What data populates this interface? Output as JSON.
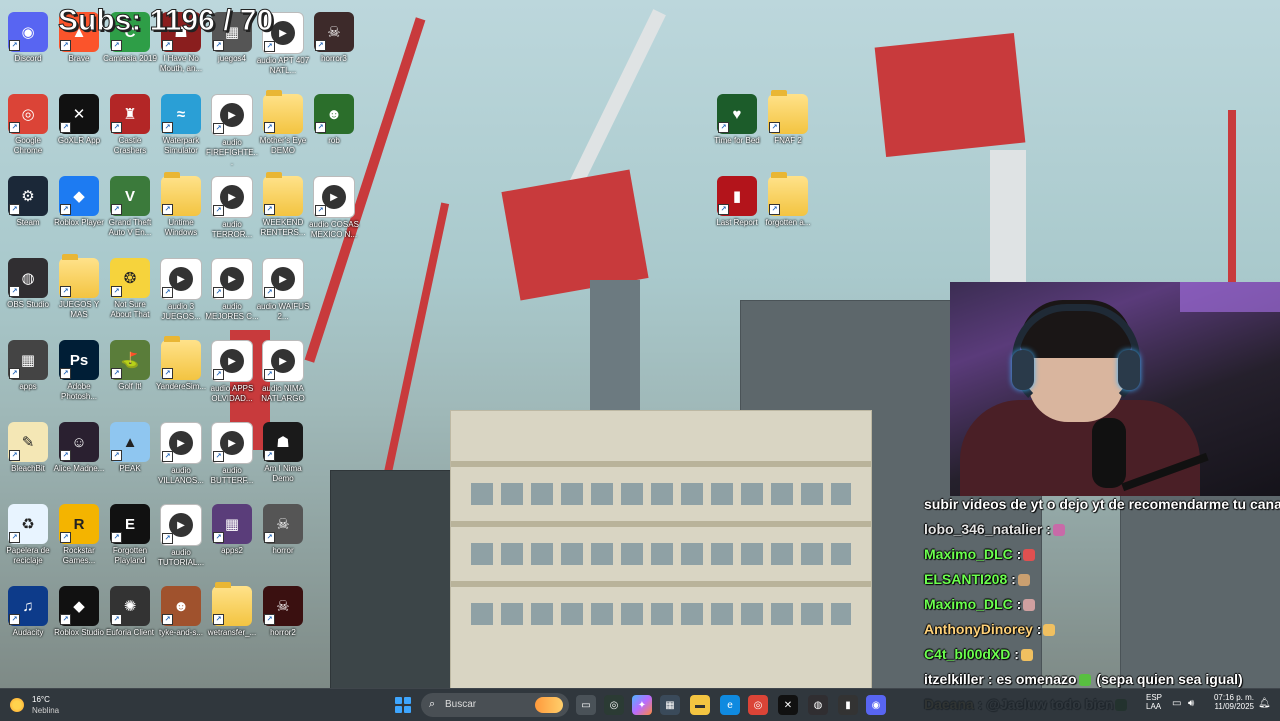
{
  "overlay": {
    "subs_text": "Subs: 1196 / 70"
  },
  "desktop": {
    "icons": [
      {
        "label": "Discord",
        "color": "#5865F2",
        "glyph": "◉"
      },
      {
        "label": "Brave",
        "color": "#fb542b",
        "glyph": "▲"
      },
      {
        "label": "Camtasia 2019",
        "color": "#2e9e47",
        "glyph": "C"
      },
      {
        "label": "I Have No Mouth, an...",
        "color": "#8a1e1e",
        "glyph": "☗"
      },
      {
        "label": "juegos4",
        "color": "#555",
        "glyph": "▦"
      },
      {
        "label": "audio APT 407 NATL...",
        "color": "#fff",
        "glyph": "▶"
      },
      {
        "label": "horror3",
        "color": "#3d2a2a",
        "glyph": "☠"
      },
      {
        "label": "Google Chrome",
        "color": "#db4437",
        "glyph": "◎"
      },
      {
        "label": "GoXLR App",
        "color": "#111",
        "glyph": "✕"
      },
      {
        "label": "Castle Crashers",
        "color": "#b32626",
        "glyph": "♜"
      },
      {
        "label": "Waterpark Simulator",
        "color": "#2a9fd6",
        "glyph": "≈"
      },
      {
        "label": "audio FIREFIGHTE...",
        "color": "#fff",
        "glyph": "▶"
      },
      {
        "label": "Mother's Eye DEMO",
        "color": "folder",
        "glyph": ""
      },
      {
        "label": "rob",
        "color": "#2b6e2b",
        "glyph": "☻"
      },
      {
        "label": "Steam",
        "color": "#1b2838",
        "glyph": "⚙"
      },
      {
        "label": "Roblox Player",
        "color": "#1d7bf2",
        "glyph": "◆"
      },
      {
        "label": "Grand Theft Auto V En...",
        "color": "#3b7a3b",
        "glyph": "V"
      },
      {
        "label": "Untime Windows",
        "color": "folder",
        "glyph": ""
      },
      {
        "label": "audio TERROR...",
        "color": "#fff",
        "glyph": "▶"
      },
      {
        "label": "WEEKEND RENTERS...",
        "color": "folder",
        "glyph": ""
      },
      {
        "label": "audio COSAS MEXICO N...",
        "color": "#fff",
        "glyph": "▶"
      },
      {
        "label": "OBS Studio",
        "color": "#302e31",
        "glyph": "◍"
      },
      {
        "label": "JUEGOS Y MAS",
        "color": "folder",
        "glyph": ""
      },
      {
        "label": "Not Sure About That",
        "color": "#f6d33c",
        "glyph": "❂"
      },
      {
        "label": "audio 3 JUEGOS...",
        "color": "#fff",
        "glyph": "▶"
      },
      {
        "label": "audio MEJORES C...",
        "color": "#fff",
        "glyph": "▶"
      },
      {
        "label": "audio WAIFUS 2...",
        "color": "#fff",
        "glyph": "▶"
      },
      {
        "label": "apps",
        "color": "#444",
        "glyph": "▦"
      },
      {
        "label": "Adobe Photosh...",
        "color": "#001e36",
        "glyph": "Ps"
      },
      {
        "label": "Golf It!",
        "color": "#5a7d3a",
        "glyph": "⛳"
      },
      {
        "label": "YandereSim...",
        "color": "folder",
        "glyph": ""
      },
      {
        "label": "audio APPS OLVIDAD...",
        "color": "#fff",
        "glyph": "▶"
      },
      {
        "label": "audio NIMA NATLARGO",
        "color": "#fff",
        "glyph": "▶"
      },
      {
        "label": "BleachBit",
        "color": "#f4e7b5",
        "glyph": "✎"
      },
      {
        "label": "Alice Madne...",
        "color": "#2a2030",
        "glyph": "☺"
      },
      {
        "label": "PEAK",
        "color": "#8fc6f0",
        "glyph": "▲"
      },
      {
        "label": "audio VILLANOS...",
        "color": "#fff",
        "glyph": "▶"
      },
      {
        "label": "audio BUTTERF...",
        "color": "#fff",
        "glyph": "▶"
      },
      {
        "label": "Am I Nima Demo",
        "color": "#1a1a1a",
        "glyph": "☗"
      },
      {
        "label": "Papelera de reciclaje",
        "color": "#e8f4ff",
        "glyph": "♻"
      },
      {
        "label": "Rockstar Games...",
        "color": "#f4b400",
        "glyph": "R"
      },
      {
        "label": "Forgotten Playland",
        "color": "#111",
        "glyph": "E"
      },
      {
        "label": "audio TUTORIAL...",
        "color": "#fff",
        "glyph": "▶"
      },
      {
        "label": "apps2",
        "color": "#5a3d7a",
        "glyph": "▦"
      },
      {
        "label": "horror",
        "color": "#555",
        "glyph": "☠"
      },
      {
        "label": "Audacity",
        "color": "#0d3b8a",
        "glyph": "♫"
      },
      {
        "label": "Roblox Studio",
        "color": "#111",
        "glyph": "◆"
      },
      {
        "label": "Euforia Client",
        "color": "#333",
        "glyph": "✺"
      },
      {
        "label": "tyke-and-s...",
        "color": "#a0522d",
        "glyph": "☻"
      },
      {
        "label": "wetransfer_...",
        "color": "folder",
        "glyph": ""
      },
      {
        "label": "horror2",
        "color": "#3a1010",
        "glyph": "☠"
      },
      {
        "label": "Time for Bed",
        "color": "#1c5c2a",
        "glyph": "♥"
      },
      {
        "label": "FNAF 2",
        "color": "folder",
        "glyph": ""
      },
      {
        "label": "Last Report",
        "color": "#b3141b",
        "glyph": "▮"
      },
      {
        "label": "forgotten a...",
        "color": "folder",
        "glyph": ""
      }
    ]
  },
  "chat": {
    "lines": [
      {
        "user": "",
        "text": "subir videos de yt o dejo yt de recomendarme tu canal?",
        "user_color": "#ffffff"
      },
      {
        "user": "lobo_346_natalier",
        "text": ":",
        "user_color": "#e6e6e6"
      },
      {
        "user": "Maximo_DLC",
        "text": ":",
        "user_color": "#6cff4f"
      },
      {
        "user": "ELSANTI208",
        "text": ":",
        "user_color": "#6cff4f"
      },
      {
        "user": "Maximo_DLC",
        "text": ":",
        "user_color": "#6cff4f"
      },
      {
        "user": "AnthonyDinorey",
        "text": ":",
        "user_color": "#ffd27a"
      },
      {
        "user": "C4t_bl00dXD",
        "text": ":",
        "user_color": "#6cff4f"
      },
      {
        "user": "itzelkiller",
        "text": ": es omenazo",
        "user_color": "#ffffff",
        "extra": "(sepa quien sea igual)"
      },
      {
        "user": "Daeana",
        "text": ": @Jaeluw todo bien",
        "user_color": "#ffd27a"
      }
    ]
  },
  "taskbar": {
    "weather_temp": "16°C",
    "weather_desc": "Neblina",
    "search_placeholder": "Buscar",
    "lang_top": "ESP",
    "lang_bottom": "LAA",
    "time": "07:16 p. m.",
    "date": "11/09/2025"
  },
  "colors": {
    "taskbar_bg": "#1e262c",
    "accent": "#3ea6ff"
  }
}
